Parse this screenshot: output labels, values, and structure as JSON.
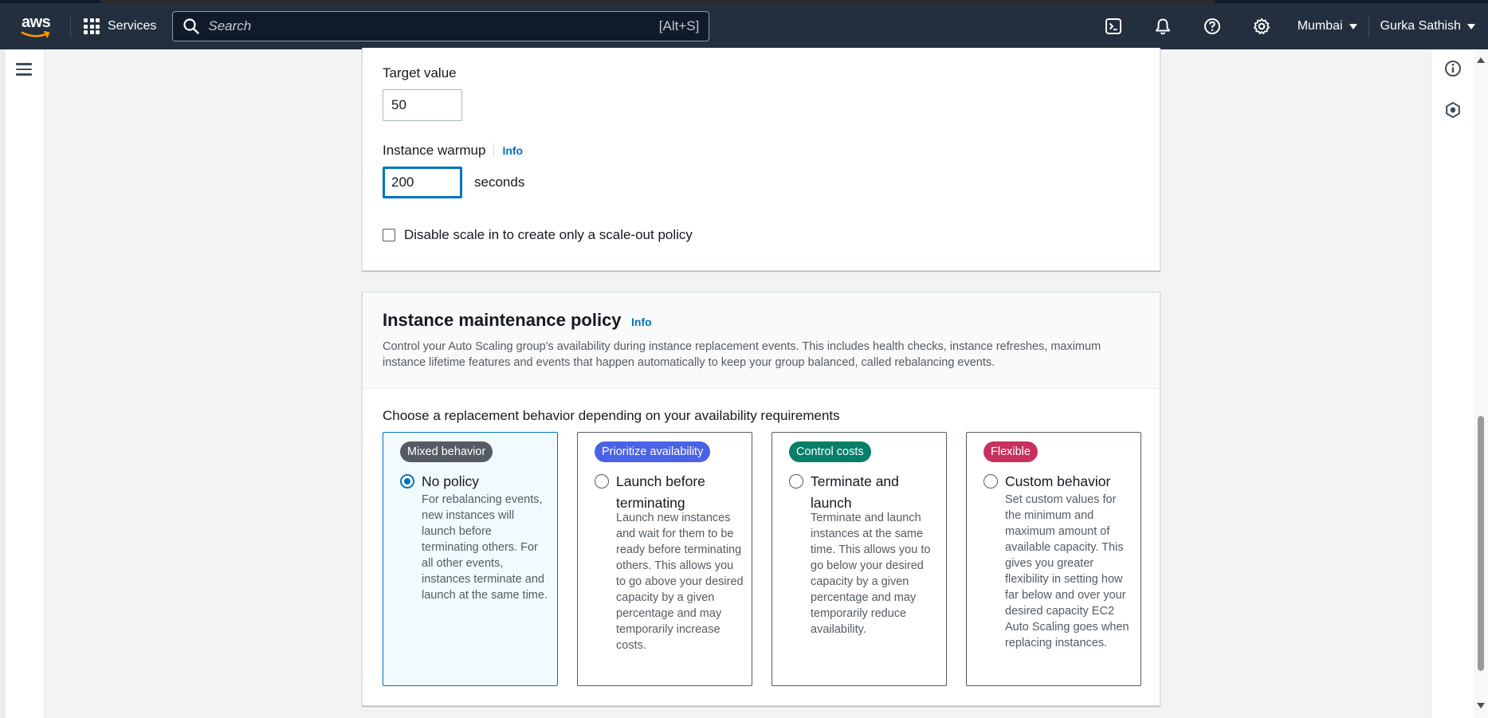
{
  "topnav": {
    "logo_text": "aws",
    "services_label": "Services",
    "search_placeholder": "Search",
    "search_shortcut": "[Alt+S]",
    "region": "Mumbai",
    "user": "Gurka Sathish"
  },
  "scaling_policy": {
    "target_value_label": "Target value",
    "target_value": "50",
    "warmup_label": "Instance warmup",
    "warmup_info": "Info",
    "warmup_value": "200",
    "warmup_unit": "seconds",
    "disable_scale_in_label": "Disable scale in to create only a scale-out policy"
  },
  "maintenance": {
    "title": "Instance maintenance policy",
    "info": "Info",
    "description": "Control your Auto Scaling group's availability during instance replacement events. This includes health checks, instance refreshes, maximum instance lifetime features and events that happen automatically to keep your group balanced, called rebalancing events.",
    "choose_label": "Choose a replacement behavior depending on your availability requirements",
    "options": [
      {
        "badge": "Mixed behavior",
        "badge_color": "#545b64",
        "title": "No policy",
        "description": "For rebalancing events, new instances will launch before terminating others. For all other events, instances terminate and launch at the same time.",
        "selected": true
      },
      {
        "badge": "Prioritize availability",
        "badge_color": "#4a62e5",
        "title": "Launch before terminating",
        "description": "Launch new instances and wait for them to be ready before terminating others. This allows you to go above your desired capacity by a given percentage and may temporarily increase costs.",
        "selected": false
      },
      {
        "badge": "Control costs",
        "badge_color": "#067f68",
        "title": "Terminate and launch",
        "description": "Terminate and launch instances at the same time. This allows you to go below your desired capacity by a given percentage and may temporarily reduce availability.",
        "selected": false
      },
      {
        "badge": "Flexible",
        "badge_color": "#c7315e",
        "title": "Custom behavior",
        "description": "Set custom values for the minimum and maximum amount of available capacity. This gives you greater flexibility in setting how far below and over your desired capacity EC2 Auto Scaling goes when replacing instances.",
        "selected": false
      }
    ]
  }
}
